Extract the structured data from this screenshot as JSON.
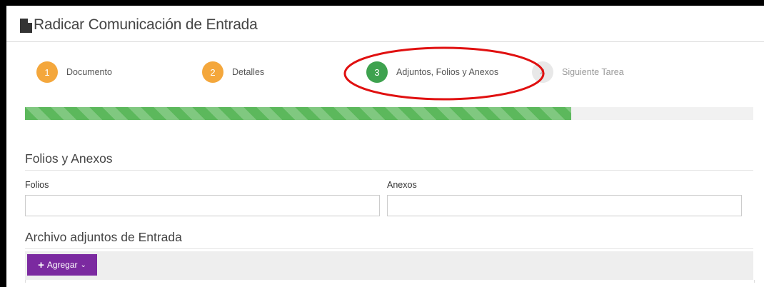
{
  "header": {
    "title": "Radicar Comunicación de Entrada",
    "icon": "document-icon"
  },
  "wizard": {
    "steps": [
      {
        "number": "1",
        "label": "Documento",
        "state": "done"
      },
      {
        "number": "2",
        "label": "Detalles",
        "state": "done"
      },
      {
        "number": "3",
        "label": "Adjuntos, Folios y Anexos",
        "state": "active"
      },
      {
        "number": "4",
        "label": "Siguiente Tarea",
        "state": "pending"
      }
    ],
    "progress": 0.75,
    "colors": {
      "done": "#f4a73c",
      "active": "#3ea24f",
      "pending": "#e8e8e8",
      "progress": "#5cb85c",
      "annotation": "#e01010"
    }
  },
  "folios_section": {
    "title": "Folios y Anexos",
    "folios_label": "Folios",
    "folios_value": "",
    "anexos_label": "Anexos",
    "anexos_value": ""
  },
  "attachments_section": {
    "title": "Archivo adjuntos de Entrada",
    "add_button_label": "Agregar",
    "add_button_icon": "plus-icon",
    "add_button_color": "#7b2aa0"
  }
}
